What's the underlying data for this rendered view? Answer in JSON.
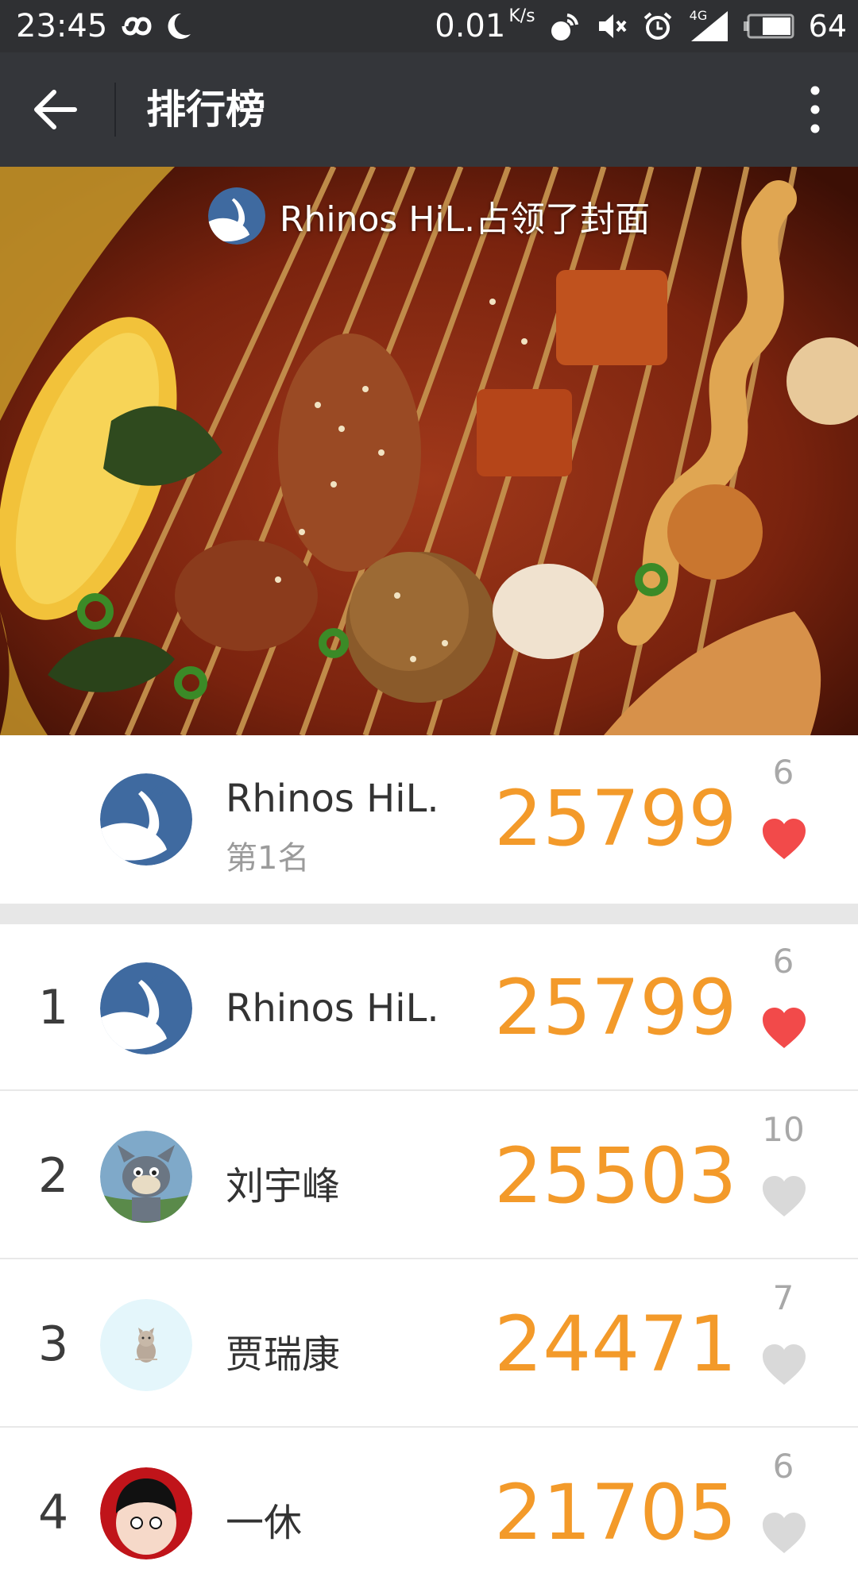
{
  "status_bar": {
    "time": "23:45",
    "net_speed": "0.01",
    "net_unit": "K/s",
    "signal_type": "4G",
    "battery_level": "64",
    "icons": [
      "infinity-icon",
      "moon-icon",
      "wifi-hotspot-icon",
      "mute-icon",
      "alarm-icon",
      "signal-icon",
      "battery-icon"
    ]
  },
  "title_bar": {
    "title": "排行榜",
    "back_icon": "arrow-left-icon",
    "more_icon": "more-vertical-icon"
  },
  "cover": {
    "owner_text": "Rhinos HiL.占领了封面",
    "image": "skewer-hotpot-photo"
  },
  "my_rank": {
    "name": "Rhinos HiL.",
    "rank_text": "第1名",
    "score": "25799",
    "likes": "6",
    "liked": true
  },
  "ranking": [
    {
      "rank": "1",
      "name": "Rhinos HiL.",
      "score": "25799",
      "likes": "6",
      "liked": true
    },
    {
      "rank": "2",
      "name": "刘宇峰",
      "score": "25503",
      "likes": "10",
      "liked": false
    },
    {
      "rank": "3",
      "name": "贾瑞康",
      "score": "24471",
      "likes": "7",
      "liked": false
    },
    {
      "rank": "4",
      "name": "一休",
      "score": "21705",
      "likes": "6",
      "liked": false
    }
  ],
  "colors": {
    "status_bar_bg": "#2f3033",
    "title_bar_bg": "#34363a",
    "score": "#f39a2a",
    "heart_active": "#f24a4a",
    "heart_inactive": "#d9d9d9"
  }
}
